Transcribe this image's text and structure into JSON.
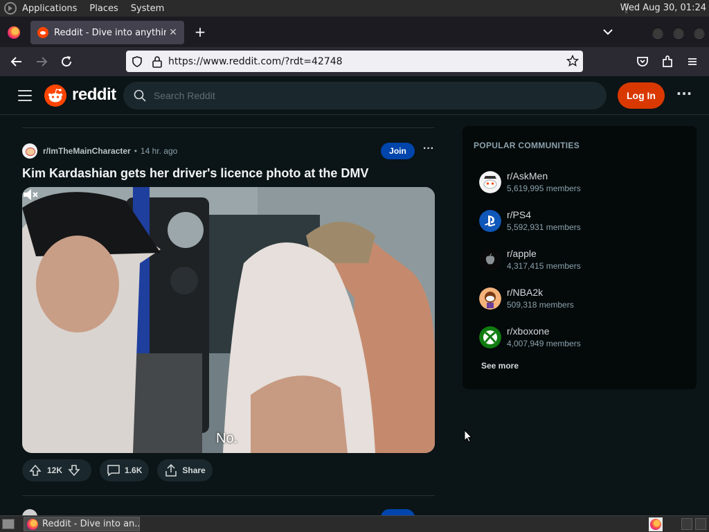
{
  "system_panel": {
    "menus": [
      "Applications",
      "Places",
      "System"
    ],
    "clock": "Wed Aug 30, 01:24"
  },
  "browser": {
    "tab_title": "Reddit - Dive into anything",
    "url": "https://www.reddit.com/?rdt=42748"
  },
  "reddit": {
    "wordmark": "reddit",
    "search_placeholder": "Search Reddit",
    "login_label": "Log In"
  },
  "post": {
    "subreddit": "r/ImTheMainCharacter",
    "separator": "•",
    "time": "14 hr. ago",
    "join_label": "Join",
    "title": "Kim Kardashian gets her driver's licence photo at the DMV",
    "video_caption": "No.",
    "upvotes": "12K",
    "comments": "1.6K",
    "share_label": "Share"
  },
  "sidebar": {
    "heading": "POPULAR COMMUNITIES",
    "communities": [
      {
        "name": "r/AskMen",
        "members": "5,619,995 members",
        "icon": "askmen-icon"
      },
      {
        "name": "r/PS4",
        "members": "5,592,931 members",
        "icon": "playstation-icon"
      },
      {
        "name": "r/apple",
        "members": "4,317,415 members",
        "icon": "apple-icon"
      },
      {
        "name": "r/NBA2k",
        "members": "509,318 members",
        "icon": "nba2k-icon"
      },
      {
        "name": "r/xboxone",
        "members": "4,007,949 members",
        "icon": "xbox-icon"
      }
    ],
    "see_more": "See more"
  },
  "taskbar": {
    "window_title": "Reddit - Dive into an..."
  },
  "colors": {
    "reddit_orange": "#ff4500",
    "login_button": "#d93900",
    "join_button": "#0045ac",
    "page_background": "#0b1416"
  }
}
